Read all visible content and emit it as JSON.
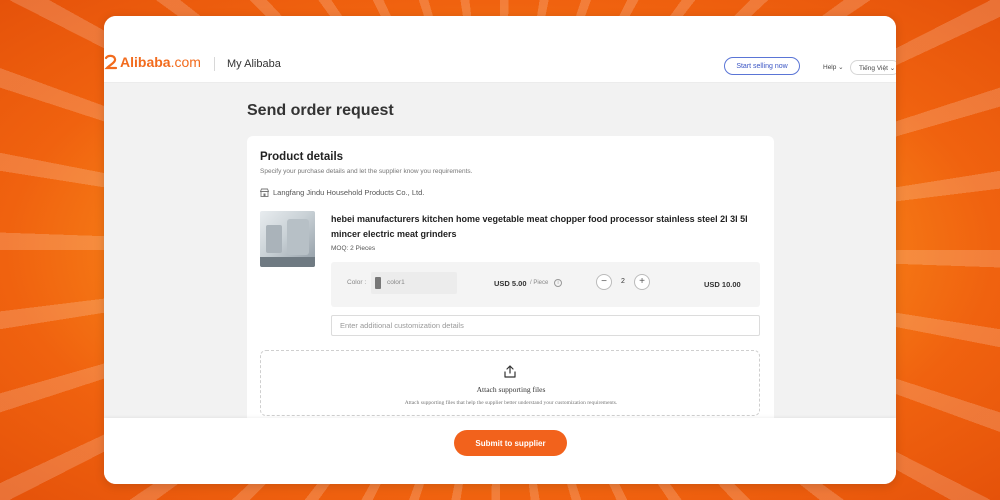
{
  "header": {
    "logo_text": "Alibaba",
    "logo_suffix": ".com",
    "section_title": "My Alibaba",
    "start_selling_label": "Start selling now",
    "help_label": "Help ⌄",
    "language_label": "Tiếng Việt ⌄"
  },
  "page": {
    "title": "Send order request"
  },
  "product_details": {
    "title": "Product details",
    "subtitle": "Specify your purchase details and let the supplier know you requirements.",
    "supplier_name": "Langfang Jindu Household Products Co., Ltd.",
    "product_title": "hebei manufacturers kitchen home vegetable meat chopper food processor stainless steel 2l 3l 5l mincer electric meat grinders",
    "moq": "MOQ: 2 Pieces",
    "variant": {
      "color_label": "Color :",
      "color_value": "color1",
      "unit_price": "USD 5.00",
      "unit_label": "/ Piece",
      "quantity": "2",
      "minus_symbol": "−",
      "plus_symbol": "+",
      "total": "USD 10.00"
    },
    "customization_placeholder": "Enter additional customization details",
    "attach": {
      "title": "Attach supporting files",
      "subtitle": "Attach supporting files that help the supplier better understand your customization requirements."
    }
  },
  "footer": {
    "submit_label": "Submit to supplier"
  },
  "colors": {
    "brand": "#f26b1d",
    "submit": "#f2621c",
    "link_blue": "#3a55c4"
  },
  "icons": [
    "alibaba-logo-icon",
    "shop-icon",
    "info-icon",
    "upload-icon"
  ]
}
